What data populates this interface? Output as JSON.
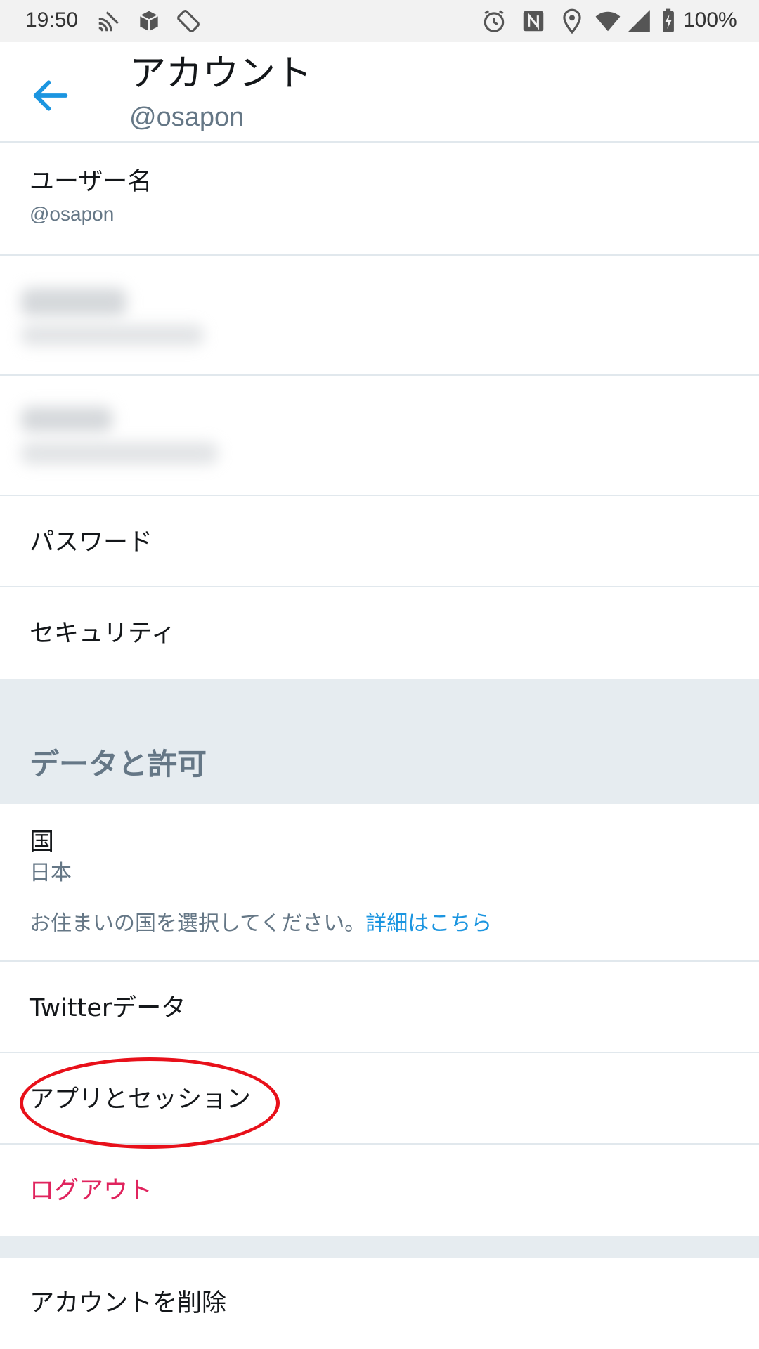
{
  "status_bar": {
    "time": "19:50",
    "battery": "100%",
    "icons": [
      "cast-icon",
      "package-icon",
      "screen-rotate-icon",
      "alarm-icon",
      "nfc-icon",
      "location-icon",
      "wifi-icon",
      "signal-icon",
      "battery-charging-icon"
    ]
  },
  "header": {
    "title": "アカウント",
    "handle": "@osapon",
    "back_icon": "arrow-left-icon",
    "accent": "#1b95e0"
  },
  "rows": {
    "username": {
      "label": "ユーザー名",
      "value": "@osapon"
    },
    "password": {
      "label": "パスワード"
    },
    "security": {
      "label": "セキュリティ"
    }
  },
  "section_data": {
    "title": "データと許可"
  },
  "country": {
    "label": "国",
    "value": "日本",
    "description": "お住まいの国を選択してください。",
    "link": "詳細はこちら"
  },
  "more_rows": {
    "twitter_data": "Twitterデータ",
    "apps_sessions": "アプリとセッション",
    "logout": "ログアウト",
    "delete_account": "アカウントを削除"
  },
  "colors": {
    "section_bg": "#e6ecf0",
    "secondary_text": "#657786",
    "logout": "#e0245e",
    "annotation_circle": "#e8101a"
  }
}
